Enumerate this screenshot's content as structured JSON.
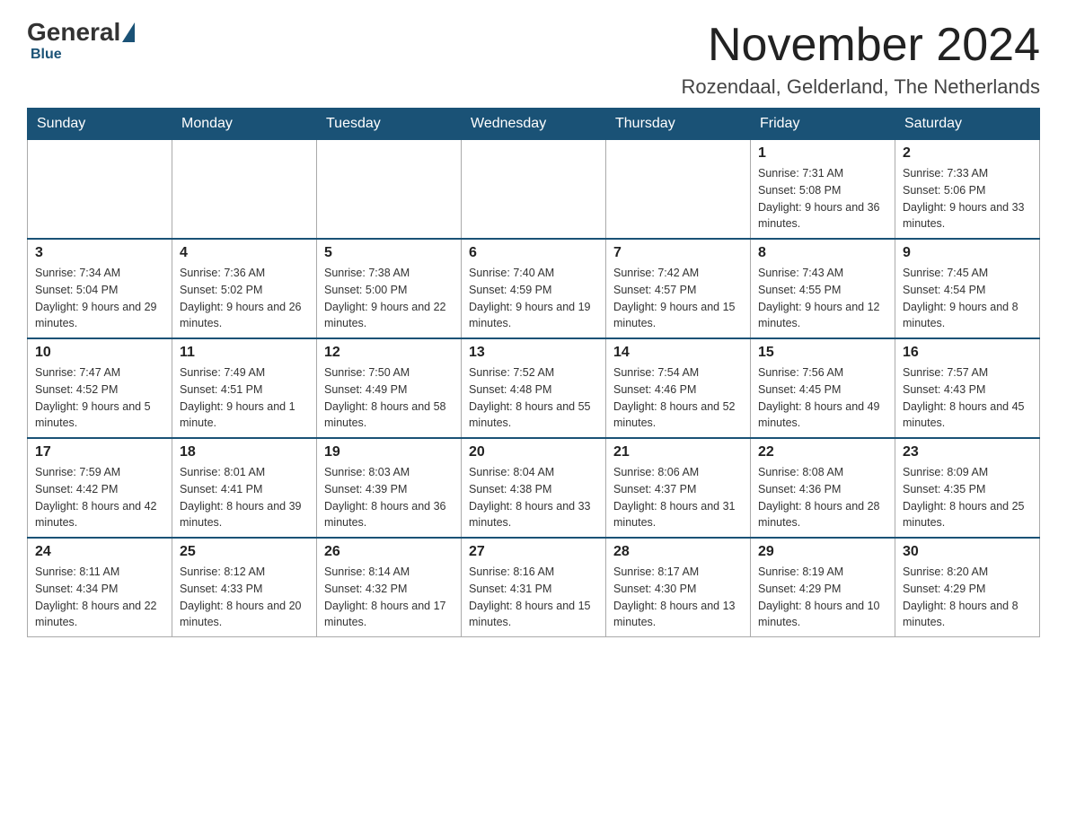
{
  "header": {
    "logo": {
      "general": "General",
      "blue": "Blue"
    },
    "month_year": "November 2024",
    "location": "Rozendaal, Gelderland, The Netherlands"
  },
  "weekdays": [
    "Sunday",
    "Monday",
    "Tuesday",
    "Wednesday",
    "Thursday",
    "Friday",
    "Saturday"
  ],
  "weeks": [
    [
      {
        "day": "",
        "info": ""
      },
      {
        "day": "",
        "info": ""
      },
      {
        "day": "",
        "info": ""
      },
      {
        "day": "",
        "info": ""
      },
      {
        "day": "",
        "info": ""
      },
      {
        "day": "1",
        "info": "Sunrise: 7:31 AM\nSunset: 5:08 PM\nDaylight: 9 hours and 36 minutes."
      },
      {
        "day": "2",
        "info": "Sunrise: 7:33 AM\nSunset: 5:06 PM\nDaylight: 9 hours and 33 minutes."
      }
    ],
    [
      {
        "day": "3",
        "info": "Sunrise: 7:34 AM\nSunset: 5:04 PM\nDaylight: 9 hours and 29 minutes."
      },
      {
        "day": "4",
        "info": "Sunrise: 7:36 AM\nSunset: 5:02 PM\nDaylight: 9 hours and 26 minutes."
      },
      {
        "day": "5",
        "info": "Sunrise: 7:38 AM\nSunset: 5:00 PM\nDaylight: 9 hours and 22 minutes."
      },
      {
        "day": "6",
        "info": "Sunrise: 7:40 AM\nSunset: 4:59 PM\nDaylight: 9 hours and 19 minutes."
      },
      {
        "day": "7",
        "info": "Sunrise: 7:42 AM\nSunset: 4:57 PM\nDaylight: 9 hours and 15 minutes."
      },
      {
        "day": "8",
        "info": "Sunrise: 7:43 AM\nSunset: 4:55 PM\nDaylight: 9 hours and 12 minutes."
      },
      {
        "day": "9",
        "info": "Sunrise: 7:45 AM\nSunset: 4:54 PM\nDaylight: 9 hours and 8 minutes."
      }
    ],
    [
      {
        "day": "10",
        "info": "Sunrise: 7:47 AM\nSunset: 4:52 PM\nDaylight: 9 hours and 5 minutes."
      },
      {
        "day": "11",
        "info": "Sunrise: 7:49 AM\nSunset: 4:51 PM\nDaylight: 9 hours and 1 minute."
      },
      {
        "day": "12",
        "info": "Sunrise: 7:50 AM\nSunset: 4:49 PM\nDaylight: 8 hours and 58 minutes."
      },
      {
        "day": "13",
        "info": "Sunrise: 7:52 AM\nSunset: 4:48 PM\nDaylight: 8 hours and 55 minutes."
      },
      {
        "day": "14",
        "info": "Sunrise: 7:54 AM\nSunset: 4:46 PM\nDaylight: 8 hours and 52 minutes."
      },
      {
        "day": "15",
        "info": "Sunrise: 7:56 AM\nSunset: 4:45 PM\nDaylight: 8 hours and 49 minutes."
      },
      {
        "day": "16",
        "info": "Sunrise: 7:57 AM\nSunset: 4:43 PM\nDaylight: 8 hours and 45 minutes."
      }
    ],
    [
      {
        "day": "17",
        "info": "Sunrise: 7:59 AM\nSunset: 4:42 PM\nDaylight: 8 hours and 42 minutes."
      },
      {
        "day": "18",
        "info": "Sunrise: 8:01 AM\nSunset: 4:41 PM\nDaylight: 8 hours and 39 minutes."
      },
      {
        "day": "19",
        "info": "Sunrise: 8:03 AM\nSunset: 4:39 PM\nDaylight: 8 hours and 36 minutes."
      },
      {
        "day": "20",
        "info": "Sunrise: 8:04 AM\nSunset: 4:38 PM\nDaylight: 8 hours and 33 minutes."
      },
      {
        "day": "21",
        "info": "Sunrise: 8:06 AM\nSunset: 4:37 PM\nDaylight: 8 hours and 31 minutes."
      },
      {
        "day": "22",
        "info": "Sunrise: 8:08 AM\nSunset: 4:36 PM\nDaylight: 8 hours and 28 minutes."
      },
      {
        "day": "23",
        "info": "Sunrise: 8:09 AM\nSunset: 4:35 PM\nDaylight: 8 hours and 25 minutes."
      }
    ],
    [
      {
        "day": "24",
        "info": "Sunrise: 8:11 AM\nSunset: 4:34 PM\nDaylight: 8 hours and 22 minutes."
      },
      {
        "day": "25",
        "info": "Sunrise: 8:12 AM\nSunset: 4:33 PM\nDaylight: 8 hours and 20 minutes."
      },
      {
        "day": "26",
        "info": "Sunrise: 8:14 AM\nSunset: 4:32 PM\nDaylight: 8 hours and 17 minutes."
      },
      {
        "day": "27",
        "info": "Sunrise: 8:16 AM\nSunset: 4:31 PM\nDaylight: 8 hours and 15 minutes."
      },
      {
        "day": "28",
        "info": "Sunrise: 8:17 AM\nSunset: 4:30 PM\nDaylight: 8 hours and 13 minutes."
      },
      {
        "day": "29",
        "info": "Sunrise: 8:19 AM\nSunset: 4:29 PM\nDaylight: 8 hours and 10 minutes."
      },
      {
        "day": "30",
        "info": "Sunrise: 8:20 AM\nSunset: 4:29 PM\nDaylight: 8 hours and 8 minutes."
      }
    ]
  ]
}
